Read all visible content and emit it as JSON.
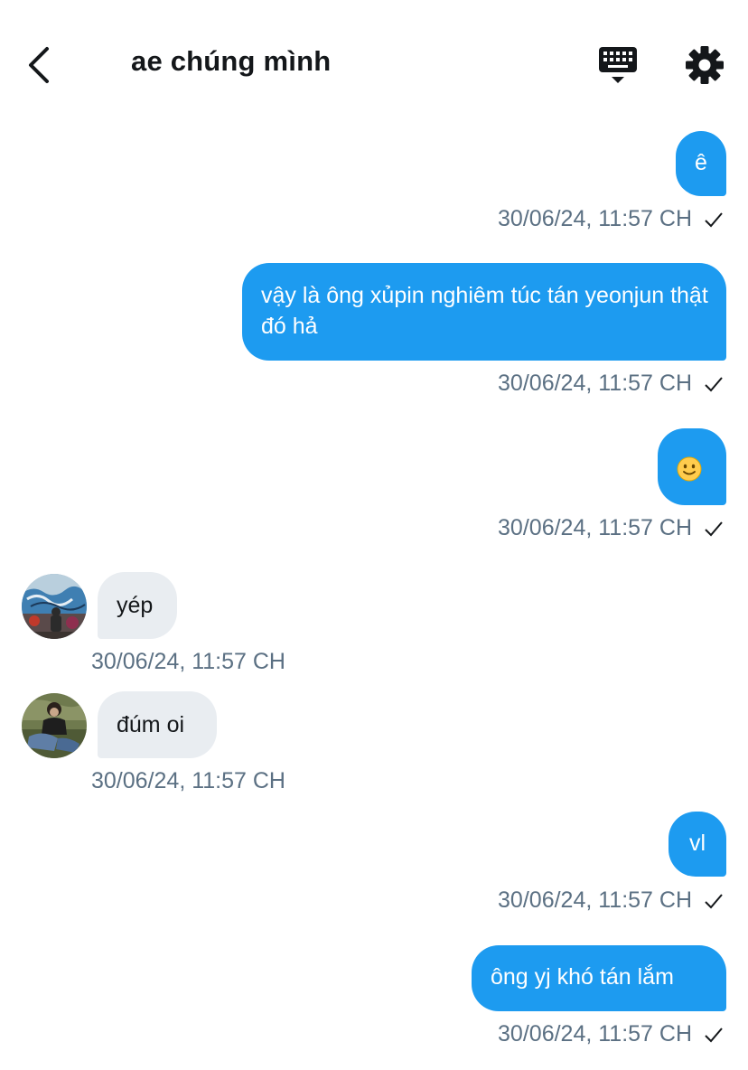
{
  "header": {
    "title": "ae chúng mình",
    "back_icon": "chevron-left-icon",
    "keyboard_icon": "keyboard-icon",
    "settings_icon": "gear-icon"
  },
  "colors": {
    "outgoing_bubble": "#1d9bf0",
    "incoming_bubble": "#e9edf1",
    "timestamp": "#5b7083"
  },
  "messages": [
    {
      "direction": "outgoing",
      "text": "ê",
      "time": "30/06/24, 11:57 CH",
      "status": "sent-check-icon"
    },
    {
      "direction": "outgoing",
      "text": "vậy là ông xủpin nghiêm túc tán yeonjun thật đó hả",
      "time": "30/06/24, 11:57 CH",
      "status": "sent-check-icon"
    },
    {
      "direction": "outgoing",
      "text": "🙂",
      "time": "30/06/24, 11:57 CH",
      "status": "sent-check-icon"
    },
    {
      "direction": "incoming",
      "text": "yép",
      "time": "30/06/24, 11:57 CH",
      "avatar": "graffiti-avatar"
    },
    {
      "direction": "incoming",
      "text": "đúm oi",
      "time": "30/06/24, 11:57 CH",
      "avatar": "person-avatar"
    },
    {
      "direction": "outgoing",
      "text": "vl",
      "time": "30/06/24, 11:57 CH",
      "status": "sent-check-icon"
    },
    {
      "direction": "outgoing",
      "text": "ông yj khó tán lắm",
      "time": "30/06/24, 11:57 CH",
      "status": "sent-check-icon"
    }
  ]
}
